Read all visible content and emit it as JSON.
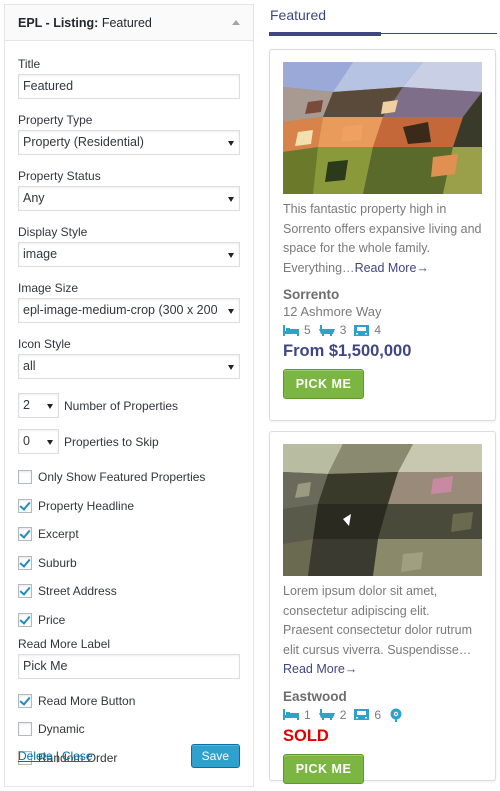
{
  "widget": {
    "title_bold": "EPL - Listing:",
    "title_name": "Featured",
    "title_field": {
      "label": "Title",
      "value": "Featured"
    },
    "property_type": {
      "label": "Property Type",
      "selected": "Property (Residential)"
    },
    "property_status": {
      "label": "Property Status",
      "selected": "Any"
    },
    "display_style": {
      "label": "Display Style",
      "selected": "image"
    },
    "image_size": {
      "label": "Image Size",
      "selected": "epl-image-medium-crop (300 x 200"
    },
    "icon_style": {
      "label": "Icon Style",
      "selected": "all"
    },
    "number_of_properties": {
      "label": "Number of Properties",
      "selected": "2"
    },
    "properties_to_skip": {
      "label": "Properties to Skip",
      "selected": "0"
    },
    "checkboxes": {
      "only_featured": {
        "label": "Only Show Featured Properties",
        "checked": false
      },
      "headline": {
        "label": "Property Headline",
        "checked": true
      },
      "excerpt": {
        "label": "Excerpt",
        "checked": true
      },
      "suburb": {
        "label": "Suburb",
        "checked": true
      },
      "street_address": {
        "label": "Street Address",
        "checked": true
      },
      "price": {
        "label": "Price",
        "checked": true
      },
      "read_more_button": {
        "label": "Read More Button",
        "checked": true
      },
      "dynamic": {
        "label": "Dynamic",
        "checked": false
      },
      "random_order": {
        "label": "Random Order",
        "checked": false
      }
    },
    "read_more_label": {
      "label": "Read More Label",
      "value": "Pick Me"
    },
    "delete_link": "Delete",
    "separator": "|",
    "close_link": "Close",
    "save_button": "Save"
  },
  "preview": {
    "section_title": "Featured",
    "listings": [
      {
        "excerpt": "This fantastic property high in Sorrento offers expansive living and space for the whole family. Everything…",
        "read_more": "Read More→",
        "suburb": "Sorrento",
        "street": "12 Ashmore Way",
        "beds": "5",
        "baths": "3",
        "cars": "4",
        "price": "From $1,500,000",
        "button": "PICK ME"
      },
      {
        "excerpt": "Lorem ipsum dolor sit amet, consectetur adipiscing elit. Praesent consectetur dolor rutrum elit cursus viverra. Suspendisse…",
        "read_more": "Read More→",
        "suburb": "Eastwood",
        "beds": "1",
        "baths": "2",
        "cars": "6",
        "status": "SOLD",
        "button": "PICK ME"
      }
    ]
  },
  "colors": {
    "accent": "#3f4684",
    "link": "#0073aa",
    "save_button": "#2ea2cc",
    "pick_button": "#7bb642",
    "sold": "#e00000",
    "feature_icon": "#2ea2cc"
  },
  "icons": [
    "collapse-arrow-icon",
    "select-arrow-icon",
    "checkmark-icon",
    "bed-icon",
    "bath-icon",
    "car-icon",
    "pool-icon"
  ]
}
